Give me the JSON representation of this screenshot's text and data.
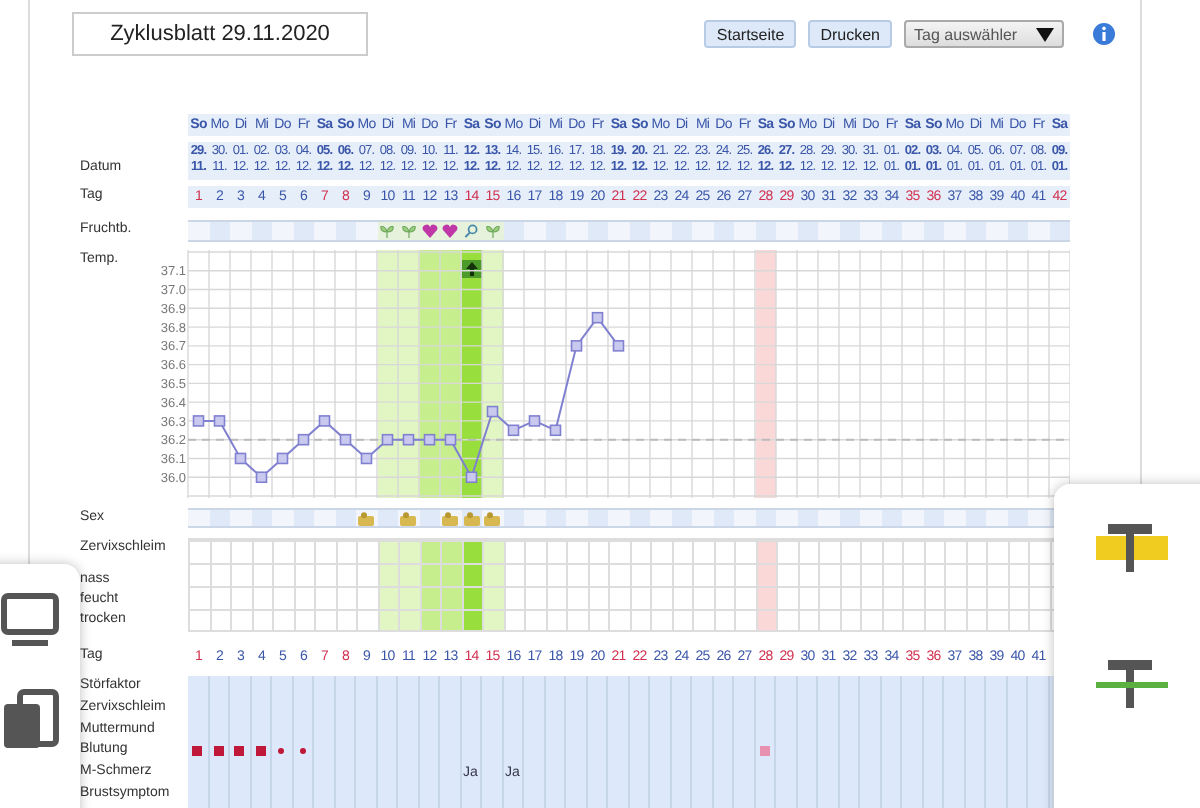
{
  "header": {
    "title": "Zyklusblatt 29.11.2020",
    "buttons": [
      "Startseite",
      "Drucken"
    ],
    "day_select": {
      "label": "Tag auswähler"
    }
  },
  "labels": {
    "datum": "Datum",
    "tag": "Tag",
    "fruchtb": "Fruchtb.",
    "sex": "Sex",
    "zervix": "Zervixschleim",
    "zervix_levels": [
      "nass",
      "feucht",
      "trocken"
    ]
  },
  "days": [
    {
      "weekday": "So",
      "date": "29. 11.",
      "number": "1",
      "weekend": true,
      "sex": false
    },
    {
      "weekday": "Mo",
      "date": "30. 11.",
      "number": "2",
      "weekend": false,
      "sex": false
    },
    {
      "weekday": "Di",
      "date": "01. 12.",
      "number": "3",
      "weekend": false,
      "sex": false
    },
    {
      "weekday": "Mi",
      "date": "02. 12.",
      "number": "4",
      "weekend": false,
      "sex": false
    },
    {
      "weekday": "Do",
      "date": "03. 12.",
      "number": "5",
      "weekend": false,
      "sex": false
    },
    {
      "weekday": "Fr",
      "date": "04. 12.",
      "number": "6",
      "weekend": false,
      "sex": false
    },
    {
      "weekday": "Sa",
      "date": "05. 12.",
      "number": "7",
      "weekend": true,
      "sex": false
    },
    {
      "weekday": "So",
      "date": "06. 12.",
      "number": "8",
      "weekend": true,
      "sex": false
    },
    {
      "weekday": "Mo",
      "date": "07. 12.",
      "number": "9",
      "weekend": false,
      "sex": true
    },
    {
      "weekday": "Di",
      "date": "08. 12.",
      "number": "10",
      "weekend": false,
      "sex": false,
      "zone": {
        "kind": "light"
      },
      "fertility": {
        "kind": "leaf"
      }
    },
    {
      "weekday": "Mi",
      "date": "09. 12.",
      "number": "11",
      "weekend": false,
      "sex": true,
      "zone": {
        "kind": "light"
      },
      "fertility": {
        "kind": "leaf"
      }
    },
    {
      "weekday": "Do",
      "date": "10. 12.",
      "number": "12",
      "weekend": false,
      "sex": false,
      "zone": {
        "kind": "mid"
      },
      "fertility": {
        "kind": "heart"
      }
    },
    {
      "weekday": "Fr",
      "date": "11. 12.",
      "number": "13",
      "weekend": false,
      "sex": true,
      "zone": {
        "kind": "mid"
      },
      "fertility": {
        "kind": "heart"
      }
    },
    {
      "weekday": "Sa",
      "date": "12. 12.",
      "number": "14",
      "weekend": true,
      "sex": true,
      "zone": {
        "kind": "peak"
      },
      "fertility": {
        "kind": "search"
      }
    },
    {
      "weekday": "So",
      "date": "13. 12.",
      "number": "15",
      "weekend": true,
      "sex": true,
      "zone": {
        "kind": "light"
      },
      "fertility": {
        "kind": "leaf"
      }
    },
    {
      "weekday": "Mo",
      "date": "14. 12.",
      "number": "16",
      "weekend": false,
      "sex": false
    },
    {
      "weekday": "Di",
      "date": "15. 12.",
      "number": "17",
      "weekend": false,
      "sex": false
    },
    {
      "weekday": "Mi",
      "date": "16. 12.",
      "number": "18",
      "weekend": false,
      "sex": false
    },
    {
      "weekday": "Do",
      "date": "17. 12.",
      "number": "19",
      "weekend": false,
      "sex": false
    },
    {
      "weekday": "Fr",
      "date": "18. 12.",
      "number": "20",
      "weekend": false,
      "sex": false
    },
    {
      "weekday": "Sa",
      "date": "19. 12.",
      "number": "21",
      "weekend": true,
      "sex": false
    },
    {
      "weekday": "So",
      "date": "20. 12.",
      "number": "22",
      "weekend": true,
      "sex": false
    },
    {
      "weekday": "Mo",
      "date": "21. 12.",
      "number": "23",
      "weekend": false,
      "sex": false
    },
    {
      "weekday": "Di",
      "date": "22. 12.",
      "number": "24",
      "weekend": false,
      "sex": false
    },
    {
      "weekday": "Mi",
      "date": "23. 12.",
      "number": "25",
      "weekend": false,
      "sex": false
    },
    {
      "weekday": "Do",
      "date": "24. 12.",
      "number": "26",
      "weekend": false,
      "sex": false
    },
    {
      "weekday": "Fr",
      "date": "25. 12.",
      "number": "27",
      "weekend": false,
      "sex": false
    },
    {
      "weekday": "Sa",
      "date": "26. 12.",
      "number": "28",
      "weekend": true,
      "sex": false,
      "zone": {
        "kind": "pink"
      }
    },
    {
      "weekday": "So",
      "date": "27. 12.",
      "number": "29",
      "weekend": true,
      "sex": false
    },
    {
      "weekday": "Mo",
      "date": "28. 12.",
      "number": "30",
      "weekend": false,
      "sex": false
    },
    {
      "weekday": "Di",
      "date": "29. 12.",
      "number": "31",
      "weekend": false,
      "sex": false
    },
    {
      "weekday": "Mi",
      "date": "30. 12.",
      "number": "32",
      "weekend": false,
      "sex": false
    },
    {
      "weekday": "Do",
      "date": "31. 12.",
      "number": "33",
      "weekend": false,
      "sex": false
    },
    {
      "weekday": "Fr",
      "date": "01. 01.",
      "number": "34",
      "weekend": false,
      "sex": false
    },
    {
      "weekday": "Sa",
      "date": "02. 01.",
      "number": "35",
      "weekend": true,
      "sex": false
    },
    {
      "weekday": "So",
      "date": "03. 01.",
      "number": "36",
      "weekend": true,
      "sex": false
    },
    {
      "weekday": "Mo",
      "date": "04. 01.",
      "number": "37",
      "weekend": false,
      "sex": false
    },
    {
      "weekday": "Di",
      "date": "05. 01.",
      "number": "38",
      "weekend": false,
      "sex": false
    },
    {
      "weekday": "Mi",
      "date": "06. 01.",
      "number": "39",
      "weekend": false,
      "sex": false
    },
    {
      "weekday": "Do",
      "date": "07. 01.",
      "number": "40",
      "weekend": false,
      "sex": false
    },
    {
      "weekday": "Fr",
      "date": "08. 01.",
      "number": "41",
      "weekend": false,
      "sex": false
    },
    {
      "weekday": "Sa",
      "date": "09. 01.",
      "number": "42",
      "weekend": true,
      "sex": false
    }
  ],
  "temperature": {
    "chart_data": {
      "type": "line",
      "grid": true,
      "series": [
        {
          "name": "Temp.",
          "color": "#8080d0",
          "marker": "square",
          "values": [
            36.3,
            36.3,
            36.1,
            36.0,
            36.1,
            36.2,
            36.3,
            36.2,
            36.1,
            36.2,
            36.2,
            36.2,
            36.2,
            36.0,
            36.35,
            36.25,
            36.3,
            36.25,
            36.7,
            36.85,
            36.7,
            null,
            null,
            null,
            null,
            null,
            null,
            null,
            null,
            null,
            null,
            null,
            null,
            null,
            null,
            null,
            null,
            null,
            null,
            null,
            null,
            null
          ]
        }
      ],
      "ylim": [
        35.9,
        37.2
      ],
      "yticks": [
        {
          "value": 36.0,
          "label": "36.0"
        },
        {
          "value": 36.1,
          "label": "36.1"
        },
        {
          "value": 36.2,
          "label": "36.2"
        },
        {
          "value": 36.3,
          "label": "36.3"
        },
        {
          "value": 36.4,
          "label": "36.4"
        },
        {
          "value": 36.5,
          "label": "36.5"
        },
        {
          "value": 36.6,
          "label": "36.6"
        },
        {
          "value": 36.7,
          "label": "36.7"
        },
        {
          "value": 36.8,
          "label": "36.8"
        },
        {
          "value": 36.9,
          "label": "36.9"
        },
        {
          "value": 37.0,
          "label": "37.0"
        },
        {
          "value": 37.1,
          "label": "37.1"
        }
      ],
      "ref_lines": [
        {
          "axis": "y",
          "value": 36.2
        }
      ]
    }
  },
  "bottom": {
    "tag_label": "Tag",
    "days": [
      {
        "number": "1",
        "weekend": true,
        "bleeding": {
          "kind": "heavy"
        }
      },
      {
        "number": "2",
        "weekend": false,
        "bleeding": {
          "kind": "heavy"
        }
      },
      {
        "number": "3",
        "weekend": false,
        "bleeding": {
          "kind": "heavy"
        }
      },
      {
        "number": "4",
        "weekend": false,
        "bleeding": {
          "kind": "heavy"
        }
      },
      {
        "number": "5",
        "weekend": false,
        "bleeding": {
          "kind": "light"
        }
      },
      {
        "number": "6",
        "weekend": false,
        "bleeding": {
          "kind": "light"
        }
      },
      {
        "number": "7",
        "weekend": true
      },
      {
        "number": "8",
        "weekend": true
      },
      {
        "number": "9",
        "weekend": false
      },
      {
        "number": "10",
        "weekend": false
      },
      {
        "number": "11",
        "weekend": false
      },
      {
        "number": "12",
        "weekend": false
      },
      {
        "number": "13",
        "weekend": false
      },
      {
        "number": "14",
        "weekend": true,
        "pain": "Ja"
      },
      {
        "number": "15",
        "weekend": true
      },
      {
        "number": "16",
        "weekend": false,
        "pain": "Ja"
      },
      {
        "number": "17",
        "weekend": false
      },
      {
        "number": "18",
        "weekend": false
      },
      {
        "number": "19",
        "weekend": false
      },
      {
        "number": "20",
        "weekend": false
      },
      {
        "number": "21",
        "weekend": true
      },
      {
        "number": "22",
        "weekend": true
      },
      {
        "number": "23",
        "weekend": false
      },
      {
        "number": "24",
        "weekend": false
      },
      {
        "number": "25",
        "weekend": false
      },
      {
        "number": "26",
        "weekend": false
      },
      {
        "number": "27",
        "weekend": false
      },
      {
        "number": "28",
        "weekend": true,
        "bleeding": {
          "kind": "spotting"
        }
      },
      {
        "number": "29",
        "weekend": true
      },
      {
        "number": "30",
        "weekend": false
      },
      {
        "number": "31",
        "weekend": false
      },
      {
        "number": "32",
        "weekend": false
      },
      {
        "number": "33",
        "weekend": false
      },
      {
        "number": "34",
        "weekend": false
      },
      {
        "number": "35",
        "weekend": true
      },
      {
        "number": "36",
        "weekend": true
      },
      {
        "number": "37",
        "weekend": false
      },
      {
        "number": "38",
        "weekend": false
      },
      {
        "number": "39",
        "weekend": false
      },
      {
        "number": "40",
        "weekend": false
      },
      {
        "number": "41",
        "weekend": false
      }
    ],
    "rows": [
      "Störfaktor",
      "Zervixschleim",
      "Muttermund",
      "Blutung",
      "M-Schmerz",
      "Brustsymptom"
    ]
  }
}
